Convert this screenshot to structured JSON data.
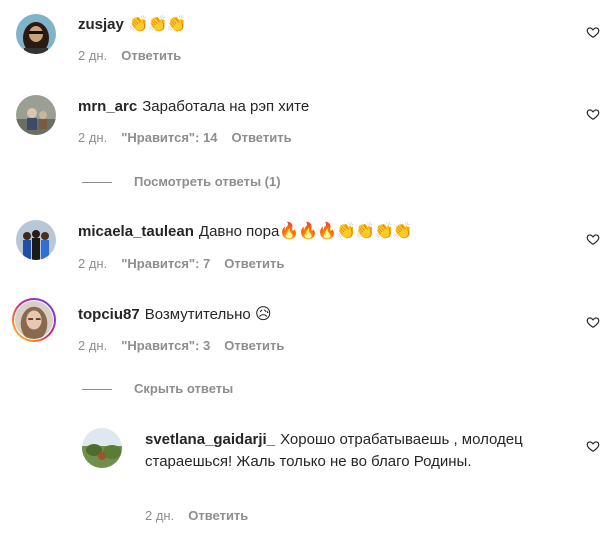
{
  "comments": [
    {
      "username": "zusjay",
      "text": "",
      "emoji": "👏👏👏",
      "time": "2 дн.",
      "reply_label": "Ответить"
    },
    {
      "username": "mrn_arc",
      "text": "Заработала на рэп хите",
      "emoji": "",
      "time": "2 дн.",
      "likes": "\"Нравится\": 14",
      "reply_label": "Ответить",
      "view_replies": "Посмотреть ответы (1)"
    },
    {
      "username": "micaela_taulean",
      "text": "Давно пора",
      "emoji": "🔥🔥🔥👏👏👏👏",
      "time": "2 дн.",
      "likes": "\"Нравится\": 7",
      "reply_label": "Ответить"
    },
    {
      "username": "topciu87",
      "text": "Возмутительно",
      "emoji": "😥",
      "time": "2 дн.",
      "likes": "\"Нравится\": 3",
      "reply_label": "Ответить",
      "hide_replies": "Скрыть ответы"
    }
  ],
  "reply": {
    "username": "svetlana_gaidarji_",
    "text": "Хорошо отрабатываешь , молодец стараешься! Жаль только не во благо Родины.",
    "time": "2 дн.",
    "reply_label": "Ответить"
  },
  "icons": {
    "like": "heart-outline-icon"
  }
}
